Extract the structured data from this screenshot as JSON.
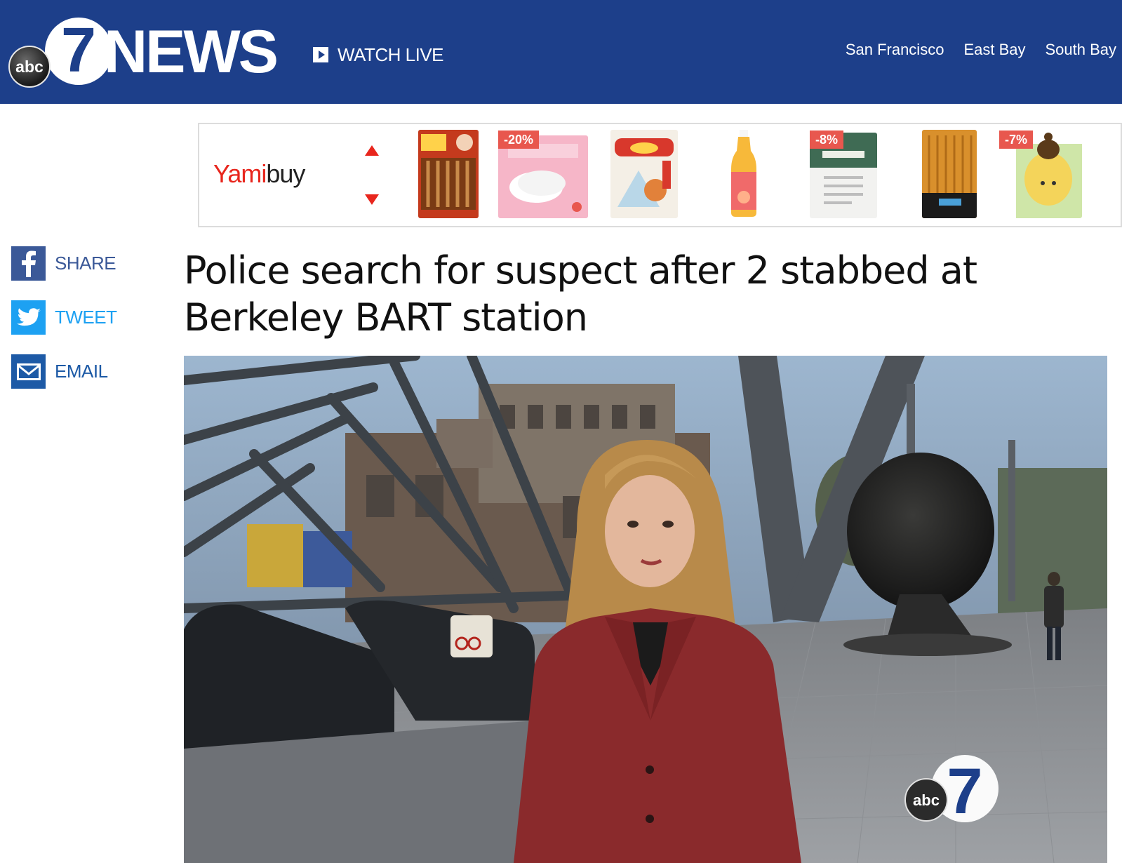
{
  "header": {
    "logo": {
      "network_badge": "abc",
      "channel_number": "7",
      "wordmark": "NEWS"
    },
    "watch_live_label": "WATCH LIVE",
    "nav": [
      "San Francisco",
      "East Bay",
      "South Bay"
    ]
  },
  "ad": {
    "brand_part1": "Yami",
    "brand_part2": "buy",
    "products": [
      {
        "name": "spicy-snack",
        "discount": ""
      },
      {
        "name": "cotton-pads",
        "discount": "-20%"
      },
      {
        "name": "chips-bag",
        "discount": ""
      },
      {
        "name": "peach-tea-bottle",
        "discount": ""
      },
      {
        "name": "face-mask",
        "discount": "-8%"
      },
      {
        "name": "dried-snack",
        "discount": ""
      },
      {
        "name": "honey-mask",
        "discount": "-7%"
      }
    ]
  },
  "share": {
    "facebook_label": "SHARE",
    "twitter_label": "TWEET",
    "email_label": "EMAIL"
  },
  "article": {
    "headline": "Police search for suspect after 2 stabbed at Berkeley BART station"
  },
  "video": {
    "watermark_badge": "abc",
    "watermark_number": "7"
  },
  "colors": {
    "header_blue": "#1d3f8a",
    "facebook_blue": "#3b5998",
    "twitter_blue": "#1da1f2",
    "email_blue": "#1d5aa6",
    "yami_red": "#e8261d"
  }
}
